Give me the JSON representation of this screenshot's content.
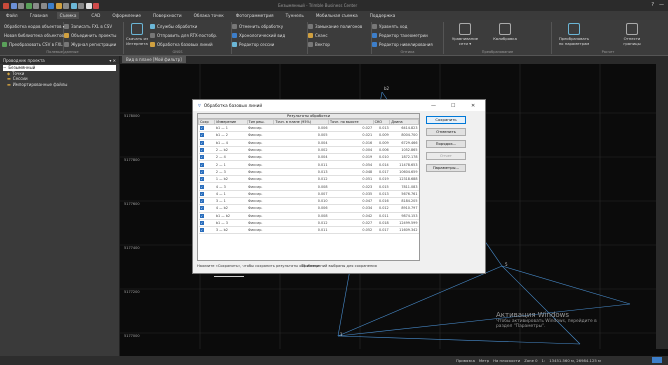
{
  "app": {
    "title": "Безымянный - Trimble Business Center"
  },
  "menu": [
    "Файл",
    "Главная",
    "Съемка",
    "CAD",
    "Оформление",
    "Поверхности",
    "Облака точек",
    "Фотограмметрия",
    "Туннель",
    "Мобильная съемка",
    "Поддержка"
  ],
  "menu_active": 2,
  "ribbon": {
    "g1": {
      "items": [
        "Обработка кодов объектов ▾",
        "Новая библиотека объектов",
        "Преобразовать CSV в FXL"
      ],
      "label": "Полевые данные"
    },
    "g1b": {
      "items": [
        "Записать FXL в CSV",
        "Объединить проекты",
        "Журнал регистрации"
      ]
    },
    "g2": {
      "big": "Скачать из Интернета",
      "items": [
        "Службы обработки",
        "Отправить для RTX-постобр.",
        "Обработка базовых линий"
      ],
      "label": "GNSS"
    },
    "g3": {
      "items": [
        "Отменить обработку",
        "Хронологический вид",
        "Редактор сессии"
      ]
    },
    "g4": {
      "items": [
        "Замыкание полигонов",
        "Сеанс",
        "Вектор"
      ]
    },
    "g5": {
      "items": [
        "Уравнять ход",
        "Редактор тахеометрии",
        "Редактор нивелирования"
      ],
      "label": "Оптика"
    },
    "g6": {
      "big": [
        "Уравнивание сети ▾",
        "Калибровка"
      ],
      "label": "Преобразование"
    },
    "g7": {
      "big": [
        "Преобразовать по параметрам",
        "Отнести границы"
      ],
      "label": "Расчет"
    }
  },
  "left_panel": {
    "title": "Проводник проекта",
    "tree": [
      "Безымянный",
      "Точки",
      "Сессии",
      "Импортированные файлы"
    ]
  },
  "view_tab": "Вид в плане [Мой фильтр]",
  "plot": {
    "y_labels": [
      "5178000",
      "5177800",
      "5177600",
      "5177400",
      "5177200",
      "5177000"
    ],
    "x_labels": [
      "",
      "",
      "",
      "",
      "",
      ""
    ],
    "points": [
      "b2",
      "5",
      "1"
    ],
    "scale": "2000 I"
  },
  "dialog": {
    "title": "Обработка базовых линий",
    "grid_title": "Результаты обработки",
    "headers": [
      "Сохр",
      "Измерение",
      "Тип реш.",
      "Точн. в плане (95%)",
      "Точн. по высоте",
      "СКО",
      "Длина"
    ],
    "rows": [
      [
        "b1 — 1",
        "Фиксир.",
        "0.006",
        "0.027",
        "0.013",
        "6414.823"
      ],
      [
        "b1 — 2",
        "Фиксир.",
        "0.005",
        "0.021",
        "0.009",
        "8004.700"
      ],
      [
        "b1 — 4",
        "Фиксир.",
        "0.004",
        "0.016",
        "0.009",
        "6729.466"
      ],
      [
        "2 — b2",
        "Фиксир.",
        "0.002",
        "0.004",
        "0.006",
        "1052.865"
      ],
      [
        "2 — 4",
        "Фиксир.",
        "0.004",
        "0.019",
        "0.010",
        "1872.178"
      ],
      [
        "2 — 1",
        "Фиксир.",
        "0.011",
        "0.054",
        "0.014",
        "11478.653"
      ],
      [
        "2 — 3",
        "Фиксир.",
        "0.013",
        "0.048",
        "0.017",
        "10604.659"
      ],
      [
        "1 — b2",
        "Фиксир.",
        "0.012",
        "0.051",
        "0.019",
        "12318.688"
      ],
      [
        "4 — 3",
        "Фиксир.",
        "0.008",
        "0.023",
        "0.015",
        "7811.083"
      ],
      [
        "4 — 1",
        "Фиксир.",
        "0.007",
        "0.035",
        "0.013",
        "5676.761"
      ],
      [
        "3 — 1",
        "Фиксир.",
        "0.010",
        "0.047",
        "0.016",
        "8184.205"
      ],
      [
        "4 — b2",
        "Фиксир.",
        "0.006",
        "0.034",
        "0.012",
        "8910.797"
      ],
      [
        "b1 — b2",
        "Фиксир.",
        "0.008",
        "0.042",
        "0.011",
        "9874.153"
      ],
      [
        "b1 — 3",
        "Фиксир.",
        "0.012",
        "0.027",
        "0.018",
        "12499.599"
      ],
      [
        "3 — b2",
        "Фиксир.",
        "0.011",
        "0.052",
        "0.017",
        "11609.342"
      ]
    ],
    "buttons": [
      "Сохранить",
      "Отменить",
      "Порядок...",
      "Отчет",
      "Параметры..."
    ],
    "footer": "Нажмите «Сохранить», чтобы сохранить результаты обработки.",
    "count": "15 измерений выбраны для сохранения"
  },
  "status": {
    "items": [
      "Привязка",
      "Метр",
      "На плоскости",
      "Zone 0",
      "1:",
      "13451.560 м, 26984.125 м"
    ]
  },
  "watermark": {
    "line1": "Активация Windows",
    "line2": "Чтобы активировать Windows, перейдите в",
    "line3": "раздел \"Параметры\"."
  },
  "colors": {
    "ui_dark": "#3c3c3c",
    "canvas": "#0b0b0b",
    "accent": "#0078d7",
    "highlight": "#2a6ebd"
  }
}
